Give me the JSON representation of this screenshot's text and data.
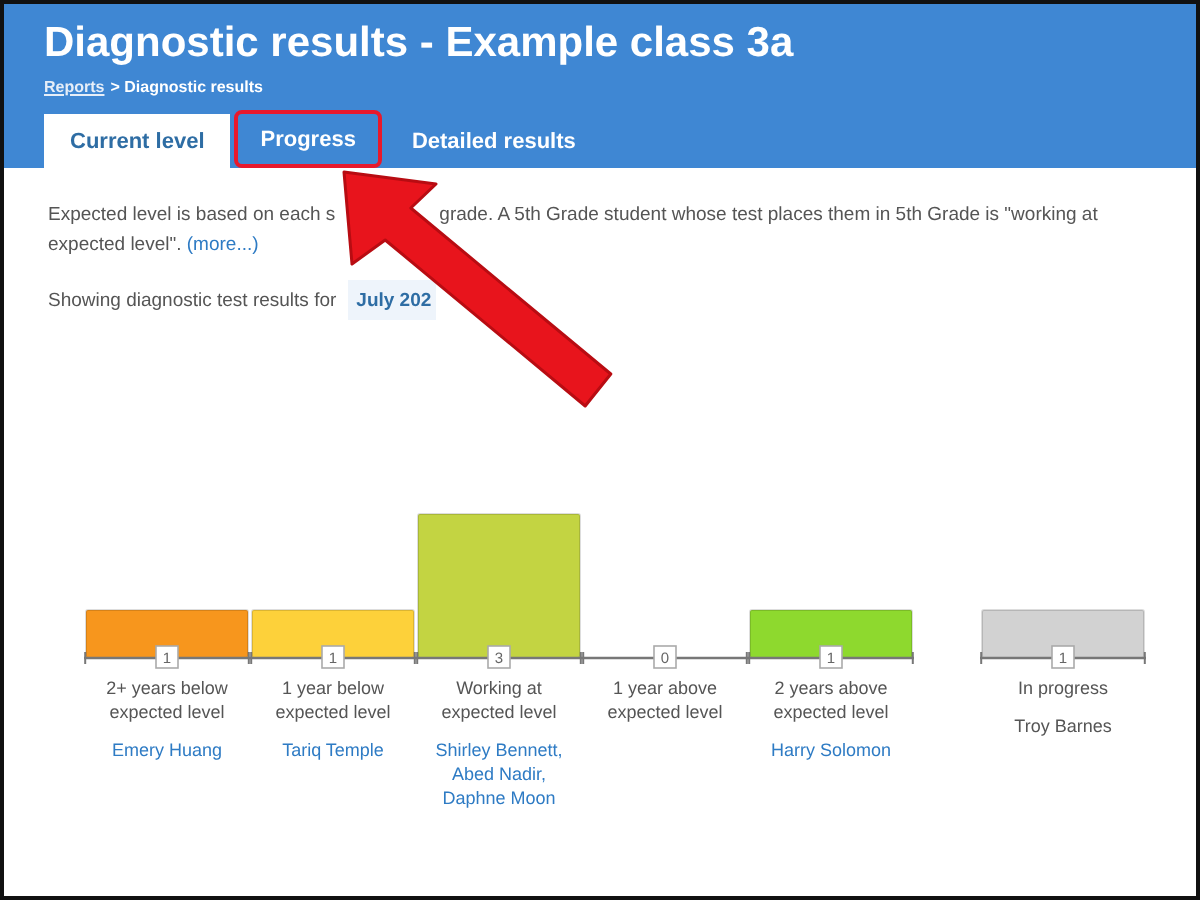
{
  "header": {
    "title": "Diagnostic results - Example class 3a",
    "breadcrumb": [
      {
        "label": "Reports",
        "kind": "link"
      },
      {
        "label": "> Diagnostic results",
        "kind": "text"
      }
    ]
  },
  "tabs": [
    {
      "label": "Current level",
      "selected": true,
      "highlighted": false
    },
    {
      "label": "Progress",
      "selected": false,
      "highlighted": true
    },
    {
      "label": "Detailed results",
      "selected": false,
      "highlighted": false
    }
  ],
  "intro": {
    "before": "Expected level is based on each s",
    "after": "grade. A 5th Grade student whose test places them in 5th Grade is \"working at expected level\".",
    "more_link": "(more...)"
  },
  "filter": {
    "label": "Showing diagnostic test results for",
    "value": "July 202"
  },
  "chart_data": {
    "type": "bar",
    "categories": [
      "2+ years below expected level",
      "1 year below expected level",
      "Working at expected level",
      "1 year above expected level",
      "2 years above expected level",
      "In progress"
    ],
    "values": [
      1,
      1,
      3,
      0,
      1,
      1
    ],
    "data_labels": true
  },
  "columns": [
    {
      "color": "#f7961d",
      "kind": "link",
      "students": "Emery Huang"
    },
    {
      "color": "#fdd13a",
      "kind": "link",
      "students": "Tariq Temple"
    },
    {
      "color": "#c3d442",
      "kind": "link",
      "students": "Shirley Bennett, Abed Nadir, Daphne Moon"
    },
    {},
    {
      "color": "#8ed92e",
      "kind": "link",
      "students": "Harry Solomon"
    },
    {
      "color": "#d2d2d2",
      "kind": "plain",
      "students": "Troy Barnes"
    }
  ]
}
